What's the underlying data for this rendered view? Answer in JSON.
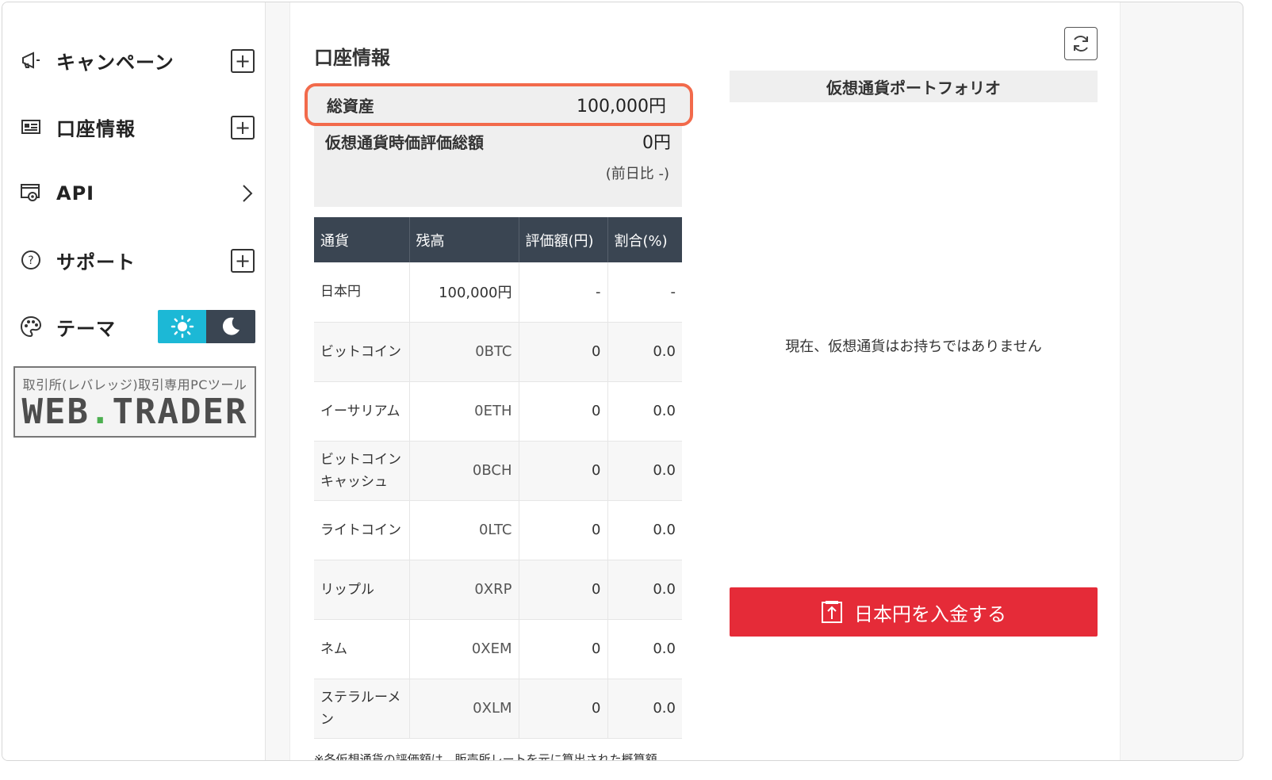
{
  "sidebar": {
    "items": [
      {
        "label": "キャンペーン",
        "icon": "megaphone-icon",
        "control": "plus"
      },
      {
        "label": "口座情報",
        "icon": "account-card-icon",
        "control": "plus"
      },
      {
        "label": "API",
        "icon": "api-gear-icon",
        "control": "chevron"
      },
      {
        "label": "サポート",
        "icon": "help-circle-icon",
        "control": "plus"
      },
      {
        "label": "テーマ",
        "icon": "palette-icon",
        "control": "theme-toggle"
      }
    ],
    "banner": {
      "subtitle": "取引所(レバレッジ)取引専用PCツール",
      "title_a": "WEB",
      "title_dot": ".",
      "title_b": "TRADER"
    }
  },
  "main": {
    "title": "口座情報",
    "summary": {
      "total_label": "総資産",
      "total_value": "100,000円",
      "crypto_label": "仮想通貨時価評価総額",
      "crypto_value": "0円",
      "change": "(前日比 -)"
    },
    "table": {
      "headers": [
        "通貨",
        "残高",
        "評価額(円)",
        "割合(%)"
      ],
      "rows": [
        {
          "name": "日本円",
          "balance": "100,000円",
          "value": "-",
          "ratio": "-"
        },
        {
          "name": "ビットコイン",
          "balance": "0BTC",
          "value": "0",
          "ratio": "0.0"
        },
        {
          "name": "イーサリアム",
          "balance": "0ETH",
          "value": "0",
          "ratio": "0.0"
        },
        {
          "name": "ビットコインキャッシュ",
          "balance": "0BCH",
          "value": "0",
          "ratio": "0.0"
        },
        {
          "name": "ライトコイン",
          "balance": "0LTC",
          "value": "0",
          "ratio": "0.0"
        },
        {
          "name": "リップル",
          "balance": "0XRP",
          "value": "0",
          "ratio": "0.0"
        },
        {
          "name": "ネム",
          "balance": "0XEM",
          "value": "0",
          "ratio": "0.0"
        },
        {
          "name": "ステラルーメン",
          "balance": "0XLM",
          "value": "0",
          "ratio": "0.0"
        }
      ]
    },
    "footnote": "※各仮想通貨の評価額は、販売所レートを元に算出された概算額"
  },
  "portfolio": {
    "title": "仮想通貨ポートフォリオ",
    "empty_message": "現在、仮想通貨はお持ちではありません",
    "deposit_label": "日本円を入金する"
  },
  "colors": {
    "accent": "#1cb8d6",
    "header_bg": "#3a4552",
    "highlight": "#f26a4b",
    "deposit": "#e52b38"
  }
}
